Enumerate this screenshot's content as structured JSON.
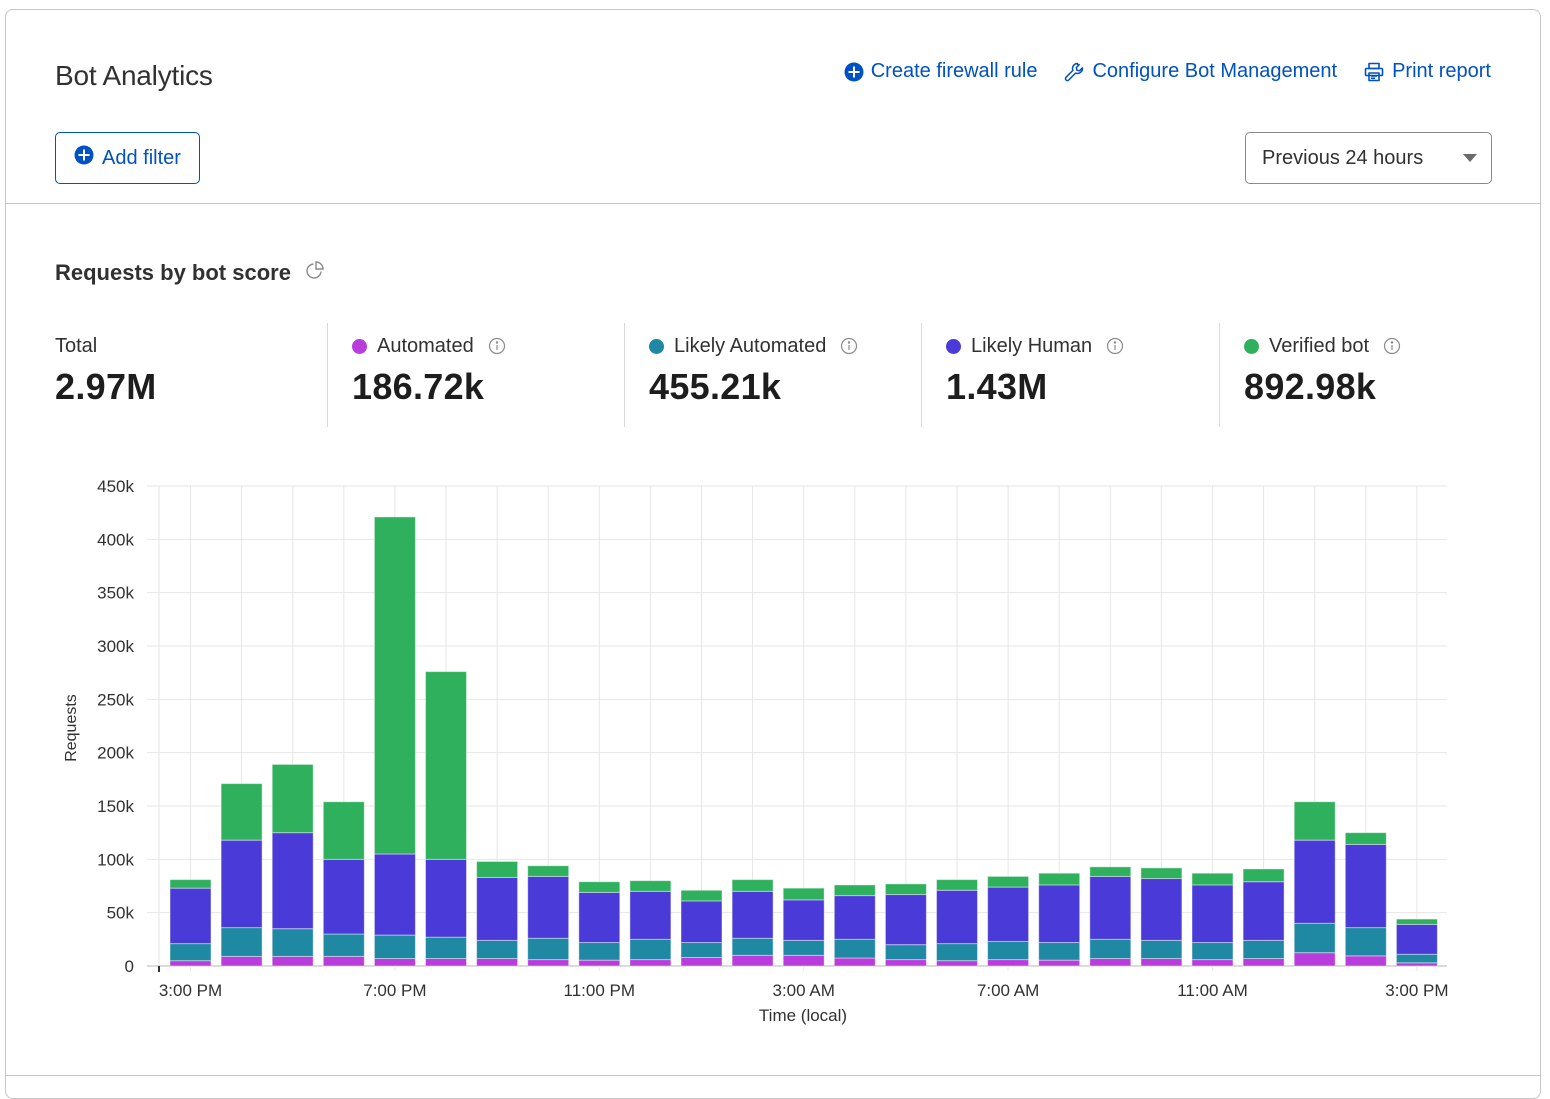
{
  "header": {
    "title": "Bot Analytics",
    "actions": [
      {
        "label": "Create firewall rule",
        "icon": "plus-circle-icon"
      },
      {
        "label": "Configure Bot Management",
        "icon": "wrench-icon"
      },
      {
        "label": "Print report",
        "icon": "printer-icon"
      }
    ],
    "add_filter_label": "Add filter",
    "time_range": {
      "selected": "Previous 24 hours"
    }
  },
  "section": {
    "title": "Requests by bot score",
    "title_icon": "pie-chart-icon"
  },
  "stats": [
    {
      "label": "Total",
      "value": "2.97M",
      "color": null
    },
    {
      "label": "Automated",
      "value": "186.72k",
      "color": "#b83ddb"
    },
    {
      "label": "Likely Automated",
      "value": "455.21k",
      "color": "#1f88a3"
    },
    {
      "label": "Likely Human",
      "value": "1.43M",
      "color": "#4a3bd9"
    },
    {
      "label": "Verified bot",
      "value": "892.98k",
      "color": "#2fb05d"
    }
  ],
  "chart_data": {
    "type": "bar",
    "stacked": true,
    "title": "",
    "xlabel": "Time (local)",
    "ylabel": "Requests",
    "ylim": [
      0,
      450000
    ],
    "yticks": [
      0,
      50000,
      100000,
      150000,
      200000,
      250000,
      300000,
      350000,
      400000,
      450000
    ],
    "ytick_labels": [
      "0",
      "50k",
      "100k",
      "150k",
      "200k",
      "250k",
      "300k",
      "350k",
      "400k",
      "450k"
    ],
    "grid": true,
    "legend": "none",
    "categories": [
      "3:00 PM",
      "4:00 PM",
      "5:00 PM",
      "6:00 PM",
      "7:00 PM",
      "8:00 PM",
      "9:00 PM",
      "10:00 PM",
      "11:00 PM",
      "12:00 AM",
      "1:00 AM",
      "2:00 AM",
      "3:00 AM",
      "4:00 AM",
      "5:00 AM",
      "6:00 AM",
      "7:00 AM",
      "8:00 AM",
      "9:00 AM",
      "10:00 AM",
      "11:00 AM",
      "12:00 PM",
      "1:00 PM",
      "2:00 PM",
      "3:00 PM"
    ],
    "xtick_labels": [
      {
        "index": 0,
        "label": "3:00 PM"
      },
      {
        "index": 4,
        "label": "7:00 PM"
      },
      {
        "index": 8,
        "label": "11:00 PM"
      },
      {
        "index": 12,
        "label": "3:00 AM"
      },
      {
        "index": 16,
        "label": "7:00 AM"
      },
      {
        "index": 20,
        "label": "11:00 AM"
      },
      {
        "index": 24,
        "label": "3:00 PM"
      }
    ],
    "series": [
      {
        "name": "Automated",
        "color": "#b83ddb",
        "values": [
          5000,
          9000,
          9000,
          9000,
          7000,
          7000,
          7000,
          6000,
          5500,
          6000,
          8000,
          10000,
          10000,
          7500,
          6000,
          5000,
          6000,
          5500,
          7000,
          7000,
          6000,
          7000,
          12500,
          9500,
          3000
        ]
      },
      {
        "name": "Likely Automated",
        "color": "#1f88a3",
        "values": [
          16000,
          27000,
          26000,
          21000,
          22000,
          20000,
          17000,
          20000,
          16500,
          19000,
          14000,
          16000,
          14000,
          17500,
          14000,
          16000,
          17000,
          16500,
          18000,
          17000,
          16000,
          17000,
          27500,
          26500,
          8000
        ]
      },
      {
        "name": "Likely Human",
        "color": "#4a3bd9",
        "values": [
          52000,
          82000,
          90000,
          70000,
          76000,
          73000,
          59000,
          58000,
          47000,
          45000,
          39000,
          44000,
          38000,
          41000,
          47000,
          50000,
          51000,
          54000,
          59000,
          58000,
          54000,
          55000,
          78000,
          78000,
          28000
        ]
      },
      {
        "name": "Verified bot",
        "color": "#2fb05d",
        "values": [
          8000,
          53000,
          64000,
          54000,
          316000,
          176000,
          15000,
          10000,
          10000,
          10000,
          10000,
          11000,
          11000,
          10000,
          10000,
          10000,
          10000,
          11000,
          9000,
          10000,
          11000,
          12000,
          36000,
          11000,
          5000
        ]
      }
    ]
  }
}
